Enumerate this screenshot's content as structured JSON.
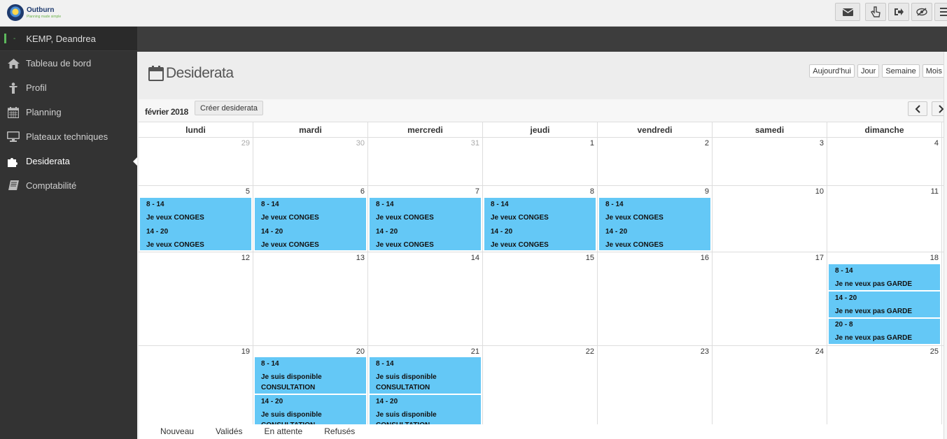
{
  "app": {
    "brand_name": "Outburn",
    "brand_tagline": "Planning made simple"
  },
  "user": {
    "status_dot": "-",
    "name": "KEMP, Deandrea"
  },
  "sidebar": {
    "items": [
      {
        "label": "Tableau de bord",
        "icon": "home-icon"
      },
      {
        "label": "Profil",
        "icon": "person-icon"
      },
      {
        "label": "Planning",
        "icon": "calendar-icon"
      },
      {
        "label": "Plateaux techniques",
        "icon": "monitor-icon"
      },
      {
        "label": "Desiderata",
        "icon": "puzzle-icon",
        "active": true
      },
      {
        "label": "Comptabilité",
        "icon": "book-icon"
      }
    ]
  },
  "page": {
    "title": "Desiderata"
  },
  "view_buttons": {
    "today": "Aujourd'hui",
    "day": "Jour",
    "week": "Semaine",
    "month": "Mois"
  },
  "calendar": {
    "month_label": "février 2018",
    "create_label": "Créer desiderata",
    "weekdays": [
      "lundi",
      "mardi",
      "mercredi",
      "jeudi",
      "vendredi",
      "samedi",
      "dimanche"
    ],
    "weeks": [
      [
        "29",
        "30",
        "31",
        "1",
        "2",
        "3",
        "4"
      ],
      [
        "5",
        "6",
        "7",
        "8",
        "9",
        "10",
        "11"
      ],
      [
        "12",
        "13",
        "14",
        "15",
        "16",
        "17",
        "18"
      ],
      [
        "19",
        "20",
        "21",
        "22",
        "23",
        "24",
        "25"
      ]
    ],
    "events": {
      "conges_time_1": "8 - 14",
      "conges_text": "Je veux CONGES",
      "conges_time_2": "14 - 20",
      "garde_time_1": "8 - 14",
      "garde_time_2": "14 - 20",
      "garde_time_3": "20 - 8",
      "garde_text": "Je ne veux pas GARDE",
      "consult_time_1": "8 - 14",
      "consult_time_2": "14 - 20",
      "consult_line_1": "Je suis disponible",
      "consult_line_2": "CONSULTATION"
    },
    "event_color": "#64c8f6"
  },
  "legend": [
    "Nouveau",
    "Validés",
    "En attente",
    "Refusés"
  ]
}
